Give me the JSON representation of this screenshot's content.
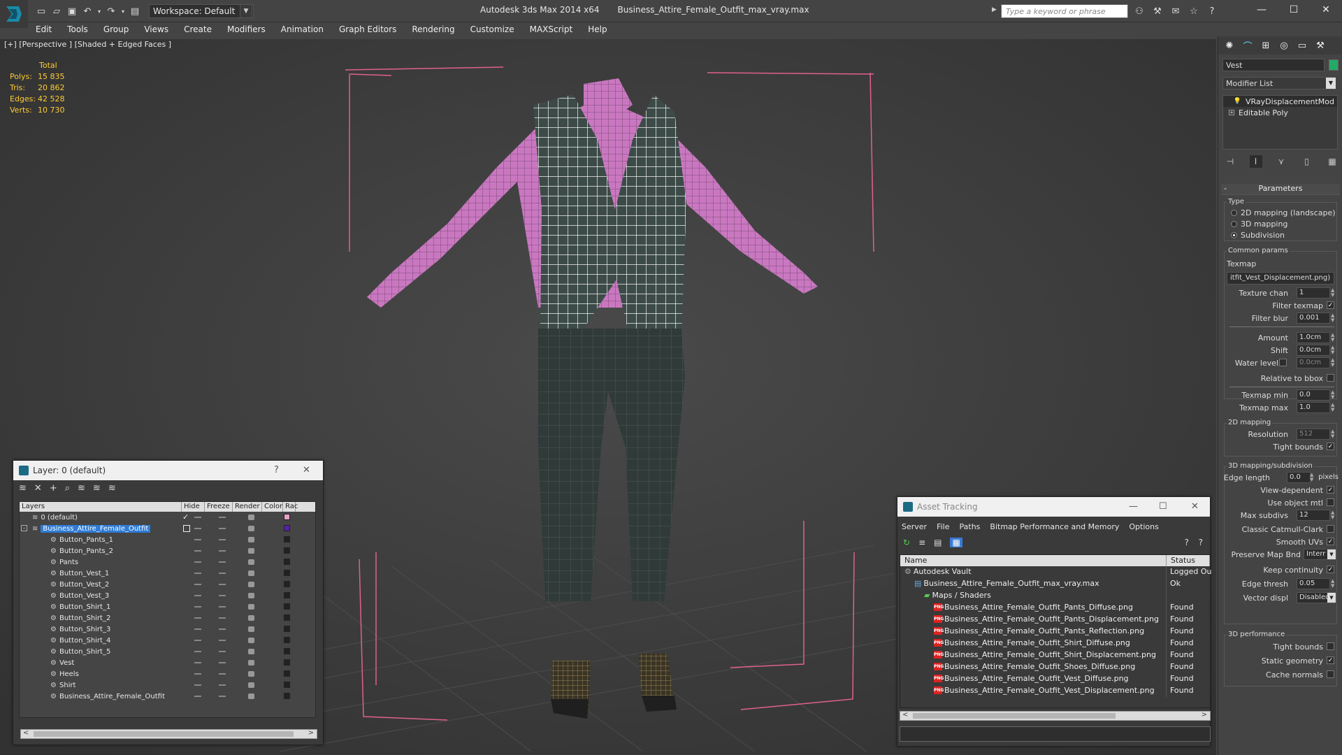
{
  "window": {
    "app_title": "Autodesk 3ds Max  2014 x64",
    "file_title": "Business_Attire_Female_Outfit_max_vray.max",
    "workspace": "Workspace: Default",
    "search_placeholder": "Type a keyword or phrase"
  },
  "menubar": [
    "Edit",
    "Tools",
    "Group",
    "Views",
    "Create",
    "Modifiers",
    "Animation",
    "Graph Editors",
    "Rendering",
    "Customize",
    "MAXScript",
    "Help"
  ],
  "viewport": {
    "label": "[+] [Perspective ] [Shaded + Edged Faces ]",
    "stats": {
      "header": "Total",
      "rows": [
        {
          "k": "Polys:",
          "v": "15 835"
        },
        {
          "k": "Tris:",
          "v": "20 862"
        },
        {
          "k": "Edges:",
          "v": "42 528"
        },
        {
          "k": "Verts:",
          "v": "10 730"
        }
      ]
    }
  },
  "command_panel": {
    "object_name": "Vest",
    "object_color": "#22aa66",
    "modifier_list": "Modifier List",
    "stack": [
      {
        "label": "VRayDisplacementMod"
      },
      {
        "label": "Editable Poly"
      }
    ],
    "parameters_title": "Parameters",
    "type_group": "Type",
    "type_options": [
      {
        "label": "2D mapping (landscape)",
        "on": false
      },
      {
        "label": "3D mapping",
        "on": false
      },
      {
        "label": "Subdivision",
        "on": true
      }
    ],
    "common_group": "Common params",
    "texmap_label": "Texmap",
    "texmap_value": "itfit_Vest_Displacement.png)",
    "texture_chan": {
      "label": "Texture chan",
      "value": "1"
    },
    "filter_texmap": {
      "label": "Filter texmap",
      "checked": true
    },
    "filter_blur": {
      "label": "Filter blur",
      "value": "0.001"
    },
    "amount": {
      "label": "Amount",
      "value": "1.0cm"
    },
    "shift": {
      "label": "Shift",
      "value": "0.0cm"
    },
    "water_level": {
      "label": "Water level",
      "value": "0.0cm"
    },
    "relative_bbox": {
      "label": "Relative to bbox",
      "checked": false
    },
    "texmap_min": {
      "label": "Texmap min",
      "value": "0.0"
    },
    "texmap_max": {
      "label": "Texmap max",
      "value": "1.0"
    },
    "mapping2d_group": "2D mapping",
    "resolution": {
      "label": "Resolution",
      "value": "512"
    },
    "tight_bounds_2d": {
      "label": "Tight bounds",
      "checked": true
    },
    "sub_group": "3D mapping/subdivision",
    "edge_length": {
      "label": "Edge length",
      "value": "0.0",
      "unit": "pixels"
    },
    "view_dependent": {
      "label": "View-dependent",
      "checked": true
    },
    "use_object_mtl": {
      "label": "Use object mtl",
      "checked": false
    },
    "max_subdivs": {
      "label": "Max subdivs",
      "value": "12"
    },
    "classic_cc": {
      "label": "Classic Catmull-Clark",
      "checked": false
    },
    "smooth_uvs": {
      "label": "Smooth UVs",
      "checked": true
    },
    "preserve_map": {
      "label": "Preserve Map Bnd",
      "value": "Interr"
    },
    "keep_continuity": {
      "label": "Keep continuity",
      "checked": true
    },
    "edge_thresh": {
      "label": "Edge thresh",
      "value": "0.05"
    },
    "vector_displ": {
      "label": "Vector displ",
      "value": "Disabled"
    },
    "perf_group": "3D performance",
    "tight_bounds_3d": {
      "label": "Tight bounds",
      "checked": false
    },
    "static_geometry": {
      "label": "Static geometry",
      "checked": true
    },
    "cache_normals": {
      "label": "Cache normals",
      "checked": false
    }
  },
  "layers_window": {
    "title": "Layer: 0 (default)",
    "help": "?",
    "columns": [
      "Layers",
      "Hide",
      "Freeze",
      "Render",
      "Color",
      "Rac"
    ],
    "rows": [
      {
        "name": "0 (default)",
        "level": 0,
        "sel": false,
        "checked": true,
        "color": "#e8a0c8"
      },
      {
        "name": "Business_Attire_Female_Outfit",
        "level": 0,
        "sel": true,
        "checked": false,
        "color": "#5522aa"
      },
      {
        "name": "Button_Pants_1",
        "level": 1,
        "color": "#222222"
      },
      {
        "name": "Button_Pants_2",
        "level": 1,
        "color": "#222222"
      },
      {
        "name": "Pants",
        "level": 1,
        "color": "#222222"
      },
      {
        "name": "Button_Vest_1",
        "level": 1,
        "color": "#222222"
      },
      {
        "name": "Button_Vest_2",
        "level": 1,
        "color": "#222222"
      },
      {
        "name": "Button_Vest_3",
        "level": 1,
        "color": "#222222"
      },
      {
        "name": "Button_Shirt_1",
        "level": 1,
        "color": "#222222"
      },
      {
        "name": "Button_Shirt_2",
        "level": 1,
        "color": "#222222"
      },
      {
        "name": "Button_Shirt_3",
        "level": 1,
        "color": "#222222"
      },
      {
        "name": "Button_Shirt_4",
        "level": 1,
        "color": "#222222"
      },
      {
        "name": "Button_Shirt_5",
        "level": 1,
        "color": "#222222"
      },
      {
        "name": "Vest",
        "level": 1,
        "color": "#222222"
      },
      {
        "name": "Heels",
        "level": 1,
        "color": "#222222"
      },
      {
        "name": "Shirt",
        "level": 1,
        "color": "#222222"
      },
      {
        "name": "Business_Attire_Female_Outfit",
        "level": 1,
        "color": "#222222"
      }
    ]
  },
  "asset_window": {
    "title": "Asset Tracking",
    "menu": [
      "Server",
      "File",
      "Paths",
      "Bitmap Performance and Memory",
      "Options"
    ],
    "columns": [
      "Name",
      "Status"
    ],
    "rows": [
      {
        "name": "Autodesk Vault",
        "level": 0,
        "status": "Logged Ou",
        "kind": "vault"
      },
      {
        "name": "Business_Attire_Female_Outfit_max_vray.max",
        "level": 1,
        "status": "Ok",
        "kind": "max"
      },
      {
        "name": "Maps / Shaders",
        "level": 2,
        "status": "",
        "kind": "folder"
      },
      {
        "name": "Business_Attire_Female_Outfit_Pants_Diffuse.png",
        "level": 3,
        "status": "Found",
        "kind": "png"
      },
      {
        "name": "Business_Attire_Female_Outfit_Pants_Displacement.png",
        "level": 3,
        "status": "Found",
        "kind": "png"
      },
      {
        "name": "Business_Attire_Female_Outfit_Pants_Reflection.png",
        "level": 3,
        "status": "Found",
        "kind": "png"
      },
      {
        "name": "Business_Attire_Female_Outfit_Shirt_Diffuse.png",
        "level": 3,
        "status": "Found",
        "kind": "png"
      },
      {
        "name": "Business_Attire_Female_Outfit_Shirt_Displacement.png",
        "level": 3,
        "status": "Found",
        "kind": "png"
      },
      {
        "name": "Business_Attire_Female_Outfit_Shoes_Diffuse.png",
        "level": 3,
        "status": "Found",
        "kind": "png"
      },
      {
        "name": "Business_Attire_Female_Outfit_Vest_Diffuse.png",
        "level": 3,
        "status": "Found",
        "kind": "png"
      },
      {
        "name": "Business_Attire_Female_Outfit_Vest_Displacement.png",
        "level": 3,
        "status": "Found",
        "kind": "png"
      }
    ]
  }
}
